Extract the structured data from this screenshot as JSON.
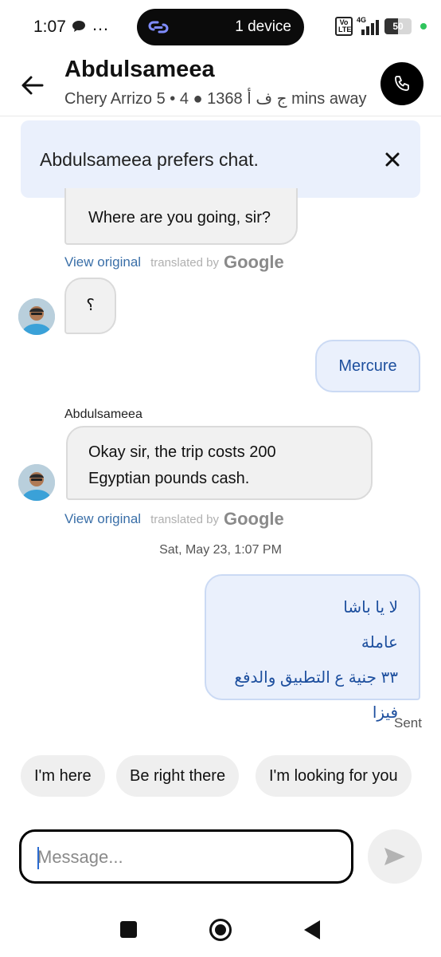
{
  "status_bar": {
    "time": "1:07",
    "more": "…",
    "pill_label": "1 device",
    "volte": "Vo LTE",
    "network": "4G",
    "battery": "50",
    "battery_level": 0.5
  },
  "header": {
    "name": "Abdulsameea",
    "car": "Chery Arrizo 5 • 4 ● 1368 ج ف أ mins away"
  },
  "banner": {
    "text": "Abdulsameea prefers chat."
  },
  "messages": {
    "m1": {
      "text": "Where are you going, sir?",
      "view_original": "View original",
      "translated_by": "translated by",
      "google": "Google"
    },
    "m2": {
      "text": "؟"
    },
    "m3": {
      "text": "Mercure"
    },
    "sender": "Abdulsameea",
    "m4": {
      "line1": "Okay sir, the trip costs 200",
      "line2": "Egyptian pounds cash.",
      "view_original": "View original",
      "translated_by": "translated by",
      "google": "Google"
    },
    "timestamp": "Sat, May 23, 1:07 PM",
    "m5": {
      "line1": "لا يا باشا",
      "line2": "عاملة",
      "line3": "٣٣ جنية ع التطبيق والدفع فيزا"
    },
    "status": "Sent"
  },
  "quick_replies": [
    "I'm here",
    "Be right there",
    "I'm looking for you"
  ],
  "compose": {
    "placeholder": "Message..."
  }
}
